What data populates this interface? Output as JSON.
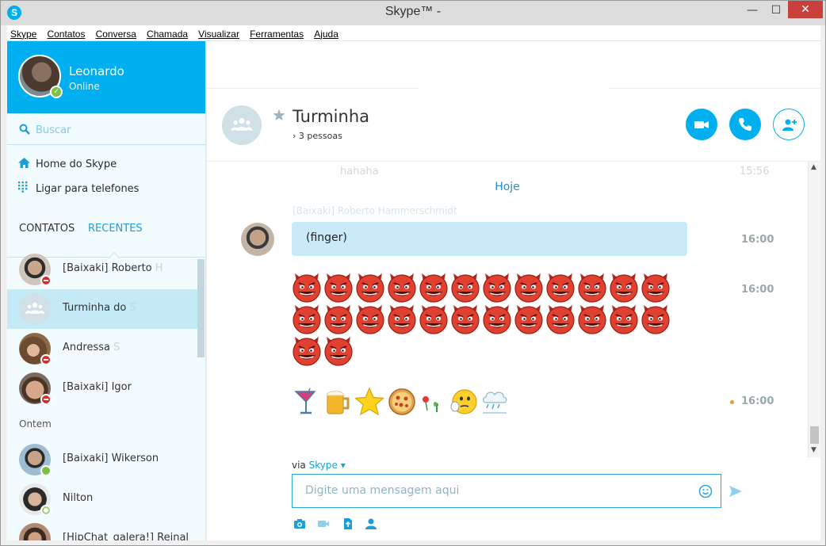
{
  "window": {
    "title": "Skype™ -",
    "minimize": "—",
    "maximize": "☐",
    "close": "✕"
  },
  "menu": [
    "Skype",
    "Contatos",
    "Conversa",
    "Chamada",
    "Visualizar",
    "Ferramentas",
    "Ajuda"
  ],
  "profile": {
    "name": "Leonardo",
    "presence": "Online"
  },
  "search": {
    "placeholder": "Buscar"
  },
  "nav": {
    "home": "Home do Skype",
    "phones": "Ligar para telefones"
  },
  "tabs": {
    "contacts": "CONTATOS",
    "recent": "RECENTES"
  },
  "recent_today": [
    {
      "name": "[Baixaki] Roberto",
      "fade": " H",
      "status": "busy"
    },
    {
      "name": "Turminha do",
      "fade": " S",
      "status": "group"
    },
    {
      "name": "Andressa",
      "fade": " S",
      "status": "busy"
    },
    {
      "name": "[Baixaki] Igor",
      "fade": "",
      "status": "busy"
    }
  ],
  "date_group": "Ontem",
  "recent_yesterday": [
    {
      "name": "[Baixaki] Wikerson",
      "fade": "",
      "status": "online"
    },
    {
      "name": "Nilton",
      "fade": "",
      "status": "offline"
    },
    {
      "name": "[HipChat_galera!] Reinal",
      "fade": "",
      "status": "busy"
    }
  ],
  "conversation": {
    "title": "Turminha",
    "members": "3 pessoas",
    "ghost_text": "hahaha",
    "ghost_time": "15:56",
    "today": "Hoje",
    "ghost_sender": "[Baixaki] Roberto Hammerschmidt",
    "messages": [
      {
        "text": "(finger)",
        "time": "16:00"
      },
      {
        "text": "",
        "time": "16:00",
        "devil_count": 26
      },
      {
        "text": "",
        "time": "16:00"
      }
    ]
  },
  "composer": {
    "via_label": "via",
    "via_link": "Skype",
    "placeholder": "Digite uma mensagem aqui"
  },
  "colors": {
    "accent": "#00aff0",
    "bubble": "#c8eaf9",
    "busy": "#d62d2d",
    "online": "#7cc242"
  }
}
